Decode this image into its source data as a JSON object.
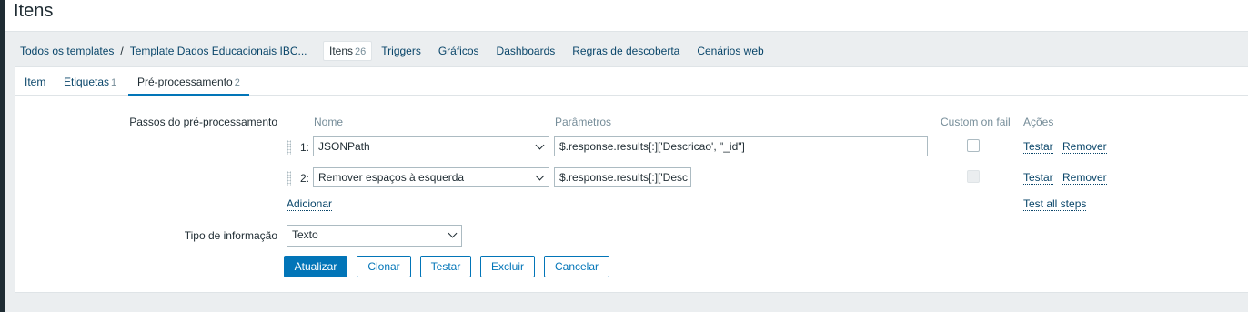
{
  "header": {
    "title": "Itens"
  },
  "breadcrumbs": {
    "all_templates": "Todos os templates",
    "separator": "/",
    "template": "Template Dados Educacionais IBC..."
  },
  "nav": [
    {
      "label": "Itens",
      "count": "26",
      "active": true
    },
    {
      "label": "Triggers"
    },
    {
      "label": "Gráficos"
    },
    {
      "label": "Dashboards"
    },
    {
      "label": "Regras de descoberta"
    },
    {
      "label": "Cenários web"
    }
  ],
  "form_tabs": [
    {
      "label": "Item",
      "count": ""
    },
    {
      "label": "Etiquetas",
      "count": "1"
    },
    {
      "label": "Pré-processamento",
      "count": "2",
      "active": true
    }
  ],
  "preprocessing": {
    "label": "Passos do pré-processamento",
    "columns": {
      "name": "Nome",
      "params": "Parâmetros",
      "custom_on_fail": "Custom on fail",
      "actions": "Ações"
    },
    "steps": [
      {
        "num": "1:",
        "name": "JSONPath",
        "param": "$.response.results[:]['Descricao', \"_id\"]",
        "test": "Testar",
        "remove": "Remover"
      },
      {
        "num": "2:",
        "name": "Remover espaços à esquerda",
        "param": "$.response.results[:]['Desc",
        "test": "Testar",
        "remove": "Remover"
      }
    ],
    "add": "Adicionar",
    "test_all": "Test all steps"
  },
  "info_type": {
    "label": "Tipo de informação",
    "value": "Texto"
  },
  "buttons": {
    "update": "Atualizar",
    "clone": "Clonar",
    "test": "Testar",
    "delete": "Excluir",
    "cancel": "Cancelar"
  },
  "colors": {
    "accent": "#0275b8",
    "link": "#0a466a",
    "background": "#ebeef0"
  }
}
